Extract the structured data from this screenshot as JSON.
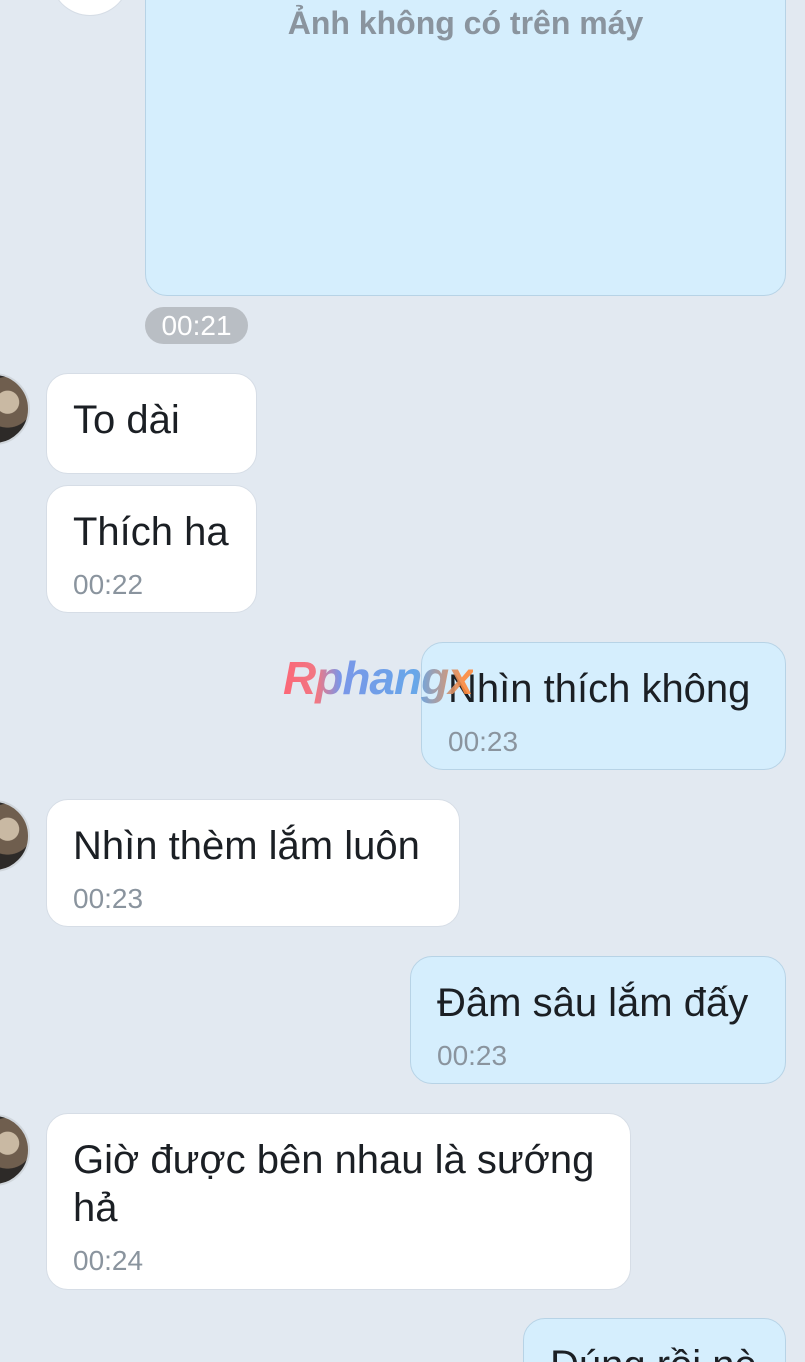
{
  "image_message": {
    "placeholder_text": "Ảnh không có trên máy",
    "time": "00:21"
  },
  "messages": [
    {
      "text": "To dài",
      "time": ""
    },
    {
      "text": "Thích ha",
      "time": "00:22"
    },
    {
      "text": "Nhìn thích không",
      "time": "00:23"
    },
    {
      "text": "Nhìn thèm lắm luôn",
      "time": "00:23"
    },
    {
      "text": "Đâm sâu lắm đấy",
      "time": "00:23"
    },
    {
      "text": "Giờ được bên nhau là sướng\nhả",
      "time": "00:24"
    },
    {
      "text": "Đúng rồi nè",
      "time": ""
    }
  ],
  "watermark": {
    "text": "Rphangx"
  },
  "colors": {
    "background": "#e2e9f1",
    "incoming_bubble": "#ffffff",
    "outgoing_bubble": "#d5eefd",
    "timestamp": "#8a949e",
    "time_pill": "#b9bec4"
  }
}
